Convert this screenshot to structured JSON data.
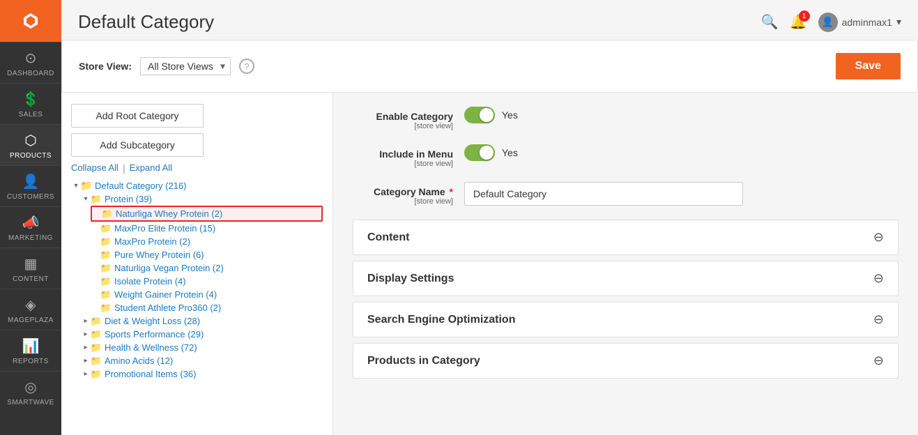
{
  "page": {
    "title": "Default Category"
  },
  "sidebar": {
    "logo_alt": "Magento Logo",
    "items": [
      {
        "id": "dashboard",
        "label": "DASHBOARD",
        "icon": "⊙"
      },
      {
        "id": "sales",
        "label": "SALES",
        "icon": "$"
      },
      {
        "id": "products",
        "label": "PRODUCTS",
        "icon": "⧫",
        "active": true
      },
      {
        "id": "customers",
        "label": "CUSTOMERS",
        "icon": "👤"
      },
      {
        "id": "marketing",
        "label": "MARKETING",
        "icon": "📣"
      },
      {
        "id": "content",
        "label": "CONTENT",
        "icon": "▦"
      },
      {
        "id": "mageplaza",
        "label": "MAGEPLAZA",
        "icon": "◈"
      },
      {
        "id": "reports",
        "label": "REPORTS",
        "icon": "📊"
      },
      {
        "id": "smartwave",
        "label": "SMARTWAVE",
        "icon": "◎"
      }
    ]
  },
  "topbar": {
    "search_title": "Search",
    "notification_count": "1",
    "user_name": "adminmax1",
    "user_icon": "👤"
  },
  "store_view": {
    "label": "Store View:",
    "value": "All Store Views",
    "help": "?",
    "save_label": "Save"
  },
  "left_panel": {
    "add_root_label": "Add Root Category",
    "add_sub_label": "Add Subcategory",
    "collapse_label": "Collapse All",
    "expand_label": "Expand All",
    "tree": {
      "root": "Default Category (216)",
      "children": [
        {
          "label": "Protein (39)",
          "children": [
            {
              "label": "Naturliga Whey Protein (2)",
              "highlighted": true
            },
            {
              "label": "MaxPro Elite Protein (15)"
            },
            {
              "label": "MaxPro Protein (2)"
            },
            {
              "label": "Pure Whey Protein (6)"
            },
            {
              "label": "Naturliga Vegan Protein (2)"
            },
            {
              "label": "Isolate Protein (4)"
            },
            {
              "label": "Weight Gainer Protein (4)"
            },
            {
              "label": "Student Athlete Pro360 (2)"
            }
          ]
        },
        {
          "label": "Diet & Weight Loss (28)"
        },
        {
          "label": "Sports Performance (29)"
        },
        {
          "label": "Health & Wellness (72)"
        },
        {
          "label": "Amino Acids (12)"
        },
        {
          "label": "Promotional Items (36)"
        }
      ]
    }
  },
  "right_panel": {
    "enable_category_label": "Enable Category",
    "enable_store_view": "[store view]",
    "enable_value": "Yes",
    "include_menu_label": "Include in Menu",
    "include_store_view": "[store view]",
    "include_value": "Yes",
    "category_name_label": "Category Name",
    "category_name_required": true,
    "category_name_store_view": "[store view]",
    "category_name_value": "Default Category",
    "sections": [
      {
        "id": "content",
        "label": "Content"
      },
      {
        "id": "display_settings",
        "label": "Display Settings"
      },
      {
        "id": "seo",
        "label": "Search Engine Optimization"
      },
      {
        "id": "products_in_category",
        "label": "Products in Category"
      }
    ]
  }
}
